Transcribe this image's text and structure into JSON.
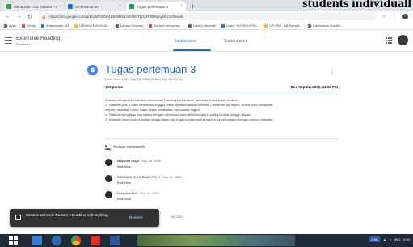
{
  "overlay": {
    "text": "students individuall"
  },
  "browser": {
    "tabs": [
      {
        "label": "Maria Zao Cruz Tadaoo - ∞",
        "active": false,
        "color": "#34a853"
      },
      {
        "label": "Smithsonia MJ",
        "active": false,
        "color": "#1a73e8"
      },
      {
        "label": "Tugas pertemuan 3",
        "active": true,
        "color": "#0f9d58"
      }
    ],
    "new_tab": "+",
    "url": "classroom.google.com/u/1/c/MTI0ODUNDMxNzAz/a/MTQ3MTM0NjAyMzA3/details",
    "bookmarks": [
      {
        "label": "Apps",
        "color": "#5f6368"
      },
      {
        "label": "Gmail",
        "color": "#ea4335"
      },
      {
        "label": "Smithsonian MJ",
        "color": "#1a73e8"
      },
      {
        "label": "LUPAKU MENGGA...",
        "color": "#fbbc04"
      },
      {
        "label": "Library Genesis",
        "color": "#5f6368"
      },
      {
        "label": "Sci-hub: removing...",
        "color": "#ea4335"
      },
      {
        "label": "Library Genesis",
        "color": "#5f6368"
      },
      {
        "label": "Login | SISTEM PEN...",
        "color": "#1a73e8"
      },
      {
        "label": "LIP PBP - Uji Kompe...",
        "color": "#fbbc04"
      },
      {
        "label": "Submission Guideli...",
        "color": "#5f6368"
      }
    ]
  },
  "classroom": {
    "class_name": "Extensive Reading",
    "class_sub": "Semester 7",
    "tabs": {
      "instructions": "Instructions",
      "student_work": "Student work"
    }
  },
  "assignment": {
    "title": "Tugas pertemuan 3",
    "meta": "Dicia Nurul Lalli • Sep 16, 2020 (Edited Sep 16, 2020)",
    "points": "100 points",
    "due": "Due Sep 23, 2020, 11:59 PM",
    "description": [
      "Setelah mengetahui manfaat membaca / Reading for pleasure, silahkan simak tugas berikut:",
      "1. Silahkan pilih 1 buku berbahasa Inggris untuk dipresentasikan selama 1 semester ke depan. Boleh buku kumpulan",
      "cerpen, motivasi, novel, kisah nyata, dll asalkan berbahasa Inggris.",
      "2. Silahkan tampilkan foto halam dengan membawa buku tersebut disini, paling lambat minggu depan.",
      "3. Mulailah baca, karena setiap minggu akan ada tugas melaporkan progress report bacaan (berupa resume chapter)."
    ]
  },
  "comments": {
    "header": "4 class comments",
    "items": [
      {
        "name": "Maysada maya",
        "date": "Sep 16, 2020",
        "text": "Baik Miss"
      },
      {
        "name": "SIDI DANI SUHERLAN PBI B",
        "date": "Sep 16, 2020",
        "text": "Baik Miss"
      },
      {
        "name": "Puseryka Noh",
        "date": "Sep 16, 2020",
        "text": "Baik miss"
      },
      {
        "name": "",
        "date": "16, 2020",
        "text": ""
      }
    ]
  },
  "snackbar": {
    "text": "Class is archived. Restore it to add or edit anything.",
    "action": "Restore"
  },
  "taskbar": {
    "tray_badge": "1.98",
    "time": "4:04",
    "lang": "IND"
  }
}
